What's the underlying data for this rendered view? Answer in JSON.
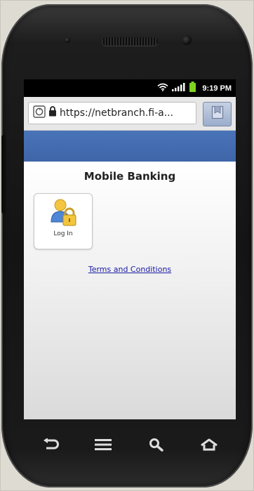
{
  "status_bar": {
    "time": "9:19 PM",
    "icons": [
      "wifi-icon",
      "signal-icon",
      "battery-icon"
    ]
  },
  "browser": {
    "url": "https://netbranch.fi-a...",
    "icons": [
      "browser-page-icon",
      "lock-icon",
      "bookmark-icon"
    ]
  },
  "page": {
    "title": "Mobile Banking",
    "login_tile": {
      "label": "Log In",
      "icon": "user-lock-icon"
    },
    "terms_link": "Terms and Conditions"
  },
  "nav_bar": {
    "buttons": [
      "back-icon",
      "menu-icon",
      "search-icon",
      "home-icon"
    ]
  },
  "colors": {
    "header_blue": "#4a74b8",
    "link_blue": "#1a1aa6",
    "battery_green": "#7ed321"
  }
}
